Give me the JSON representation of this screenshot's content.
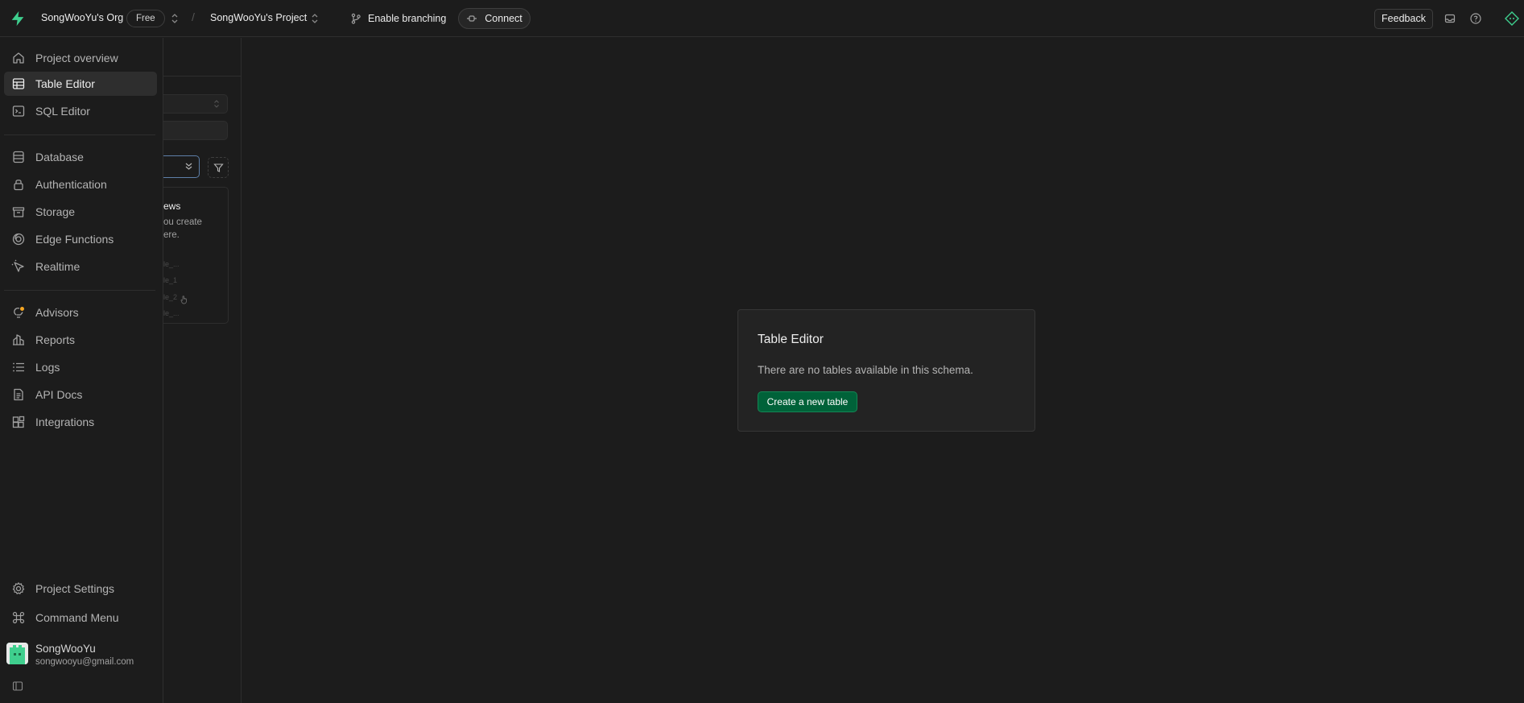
{
  "topbar": {
    "org_name": "SongWooYu's Org",
    "plan": "Free",
    "separator": "/",
    "project_name": "SongWooYu's Project",
    "branching_label": "Enable branching",
    "connect_label": "Connect",
    "feedback_label": "Feedback"
  },
  "nav": {
    "items": [
      {
        "label": "Project overview",
        "icon": "home-icon"
      },
      {
        "label": "Table Editor",
        "icon": "table-icon",
        "active": true
      },
      {
        "label": "SQL Editor",
        "icon": "terminal-icon"
      },
      {
        "label": "Database",
        "icon": "database-icon"
      },
      {
        "label": "Authentication",
        "icon": "lock-icon"
      },
      {
        "label": "Storage",
        "icon": "archive-icon"
      },
      {
        "label": "Edge Functions",
        "icon": "functions-icon"
      },
      {
        "label": "Realtime",
        "icon": "realtime-icon"
      },
      {
        "label": "Advisors",
        "icon": "lightbulb-icon"
      },
      {
        "label": "Reports",
        "icon": "chart-icon"
      },
      {
        "label": "Logs",
        "icon": "list-icon"
      },
      {
        "label": "API Docs",
        "icon": "file-icon"
      },
      {
        "label": "Integrations",
        "icon": "blocks-icon"
      }
    ],
    "bottom": [
      {
        "label": "Project Settings",
        "icon": "gear-icon"
      },
      {
        "label": "Command Menu",
        "icon": "command-icon"
      }
    ],
    "user": {
      "name": "SongWooYu",
      "email": "songwooyu@gmail.com"
    }
  },
  "panel": {
    "card_title": "ews",
    "card_desc": "ou create\nere.",
    "ghost_rows": [
      "le_...",
      "le_1",
      "le_2",
      "le_..."
    ]
  },
  "main": {
    "dialog_title": "Table Editor",
    "dialog_text": "There are no tables available in this schema.",
    "create_button": "Create a new table"
  },
  "colors": {
    "brand": "#3ecf8e",
    "primary_button": "#006239",
    "advisor_dot": "#f5a623"
  }
}
